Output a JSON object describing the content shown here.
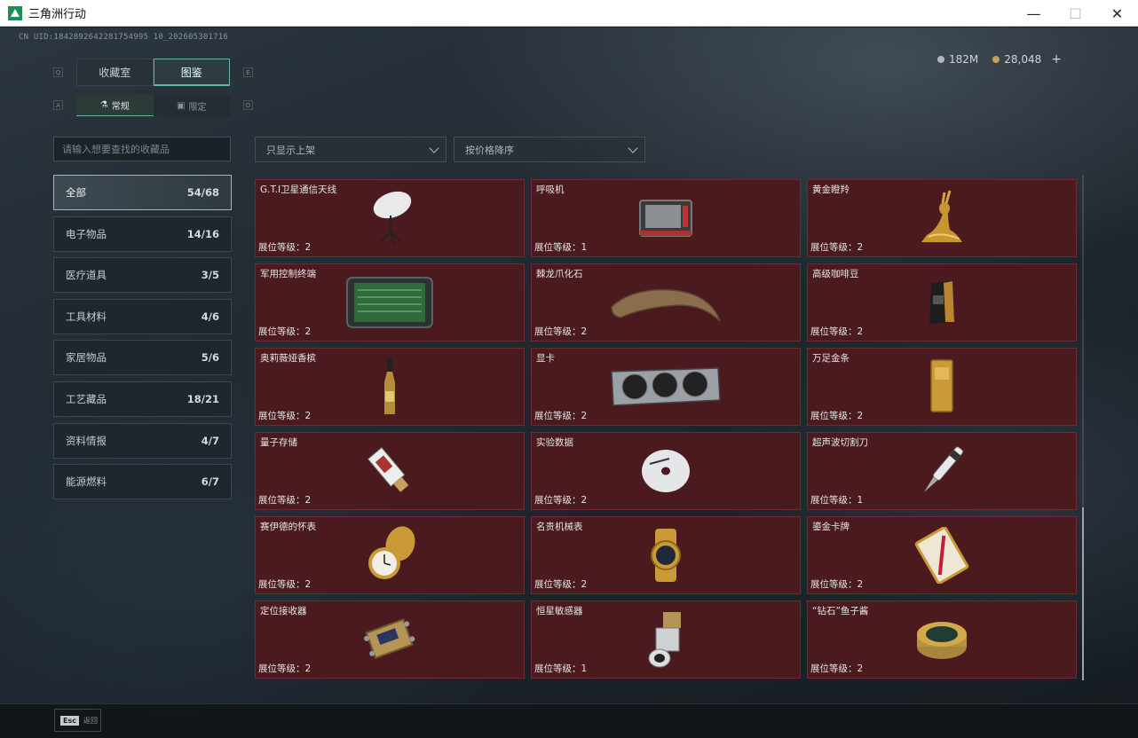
{
  "window": {
    "title": "三角洲行动",
    "minimize": "—",
    "maximize": "☐",
    "close": "✕"
  },
  "header": {
    "uid": "CN UID:1842892642281754995 10_202605301716",
    "currency": [
      {
        "icon": "silver-coin-icon",
        "value": "182M"
      },
      {
        "icon": "gold-coin-icon",
        "value": "28,048",
        "add": "+"
      }
    ]
  },
  "tabs": {
    "key_left": "Q",
    "key_right": "E",
    "items": [
      {
        "label": "收藏室"
      },
      {
        "label": "图鉴"
      }
    ],
    "active": 1
  },
  "subtabs": {
    "key_left": "A",
    "key_right": "D",
    "items": [
      {
        "label": "常规",
        "icon": "flask-icon"
      },
      {
        "label": "限定",
        "icon": "box-icon"
      }
    ],
    "active": 0
  },
  "search": {
    "placeholder": "请输入想要查找的收藏品"
  },
  "filters": {
    "display": "只显示上架",
    "sort": "按价格降序"
  },
  "categories": [
    {
      "label": "全部",
      "count": "54/68"
    },
    {
      "label": "电子物品",
      "count": "14/16"
    },
    {
      "label": "医疗道具",
      "count": "3/5"
    },
    {
      "label": "工具材料",
      "count": "4/6"
    },
    {
      "label": "家居物品",
      "count": "5/6"
    },
    {
      "label": "工艺藏品",
      "count": "18/21"
    },
    {
      "label": "资料情报",
      "count": "4/7"
    },
    {
      "label": "能源燃料",
      "count": "6/7"
    }
  ],
  "items": [
    {
      "name": "G.T.I卫星通信天线",
      "level": "展位等级：2",
      "icon": "satellite-dish-icon"
    },
    {
      "name": "呼吸机",
      "level": "展位等级：1",
      "icon": "ventilator-icon"
    },
    {
      "name": "黄金瞪羚",
      "level": "展位等级：2",
      "icon": "gold-gazelle-icon"
    },
    {
      "name": "军用控制终端",
      "level": "展位等级：2",
      "icon": "control-terminal-icon"
    },
    {
      "name": "棘龙爪化石",
      "level": "展位等级：2",
      "icon": "claw-fossil-icon"
    },
    {
      "name": "高级咖啡豆",
      "level": "展位等级：2",
      "icon": "coffee-bag-icon"
    },
    {
      "name": "奥莉薇娅香槟",
      "level": "展位等级：2",
      "icon": "champagne-bottle-icon"
    },
    {
      "name": "显卡",
      "level": "展位等级：2",
      "icon": "graphics-card-icon"
    },
    {
      "name": "万足金条",
      "level": "展位等级：2",
      "icon": "gold-bar-icon"
    },
    {
      "name": "量子存储",
      "level": "展位等级：2",
      "icon": "usb-drive-icon"
    },
    {
      "name": "实验数据",
      "level": "展位等级：2",
      "icon": "disc-icon"
    },
    {
      "name": "超声波切割刀",
      "level": "展位等级：1",
      "icon": "cutter-icon"
    },
    {
      "name": "赛伊德的怀表",
      "level": "展位等级：2",
      "icon": "pocket-watch-icon"
    },
    {
      "name": "名贵机械表",
      "level": "展位等级：2",
      "icon": "wristwatch-icon"
    },
    {
      "name": "鎏金卡牌",
      "level": "展位等级：2",
      "icon": "gilded-card-icon"
    },
    {
      "name": "定位接收器",
      "level": "展位等级：2",
      "icon": "receiver-icon"
    },
    {
      "name": "恒星敏感器",
      "level": "展位等级：1",
      "icon": "star-sensor-icon"
    },
    {
      "name": "“钻石”鱼子酱",
      "level": "展位等级：2",
      "icon": "caviar-tin-icon"
    }
  ],
  "footer": {
    "esc_key": "Esc",
    "back_label": "返回"
  }
}
